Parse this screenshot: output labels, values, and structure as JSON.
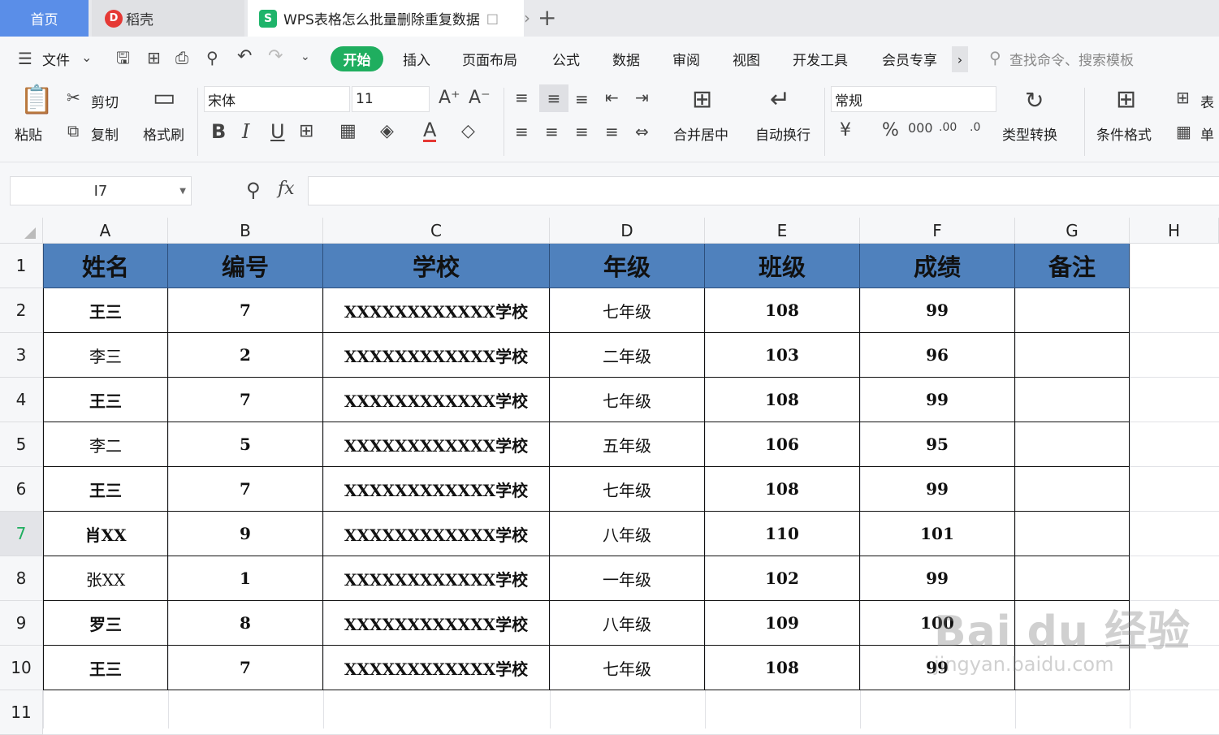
{
  "tabs": {
    "home": "首页",
    "daoke": "稻壳",
    "doc": "WPS表格怎么批量删除重复数据"
  },
  "menu": {
    "file": "文件",
    "items": [
      "开始",
      "插入",
      "页面布局",
      "公式",
      "数据",
      "审阅",
      "视图",
      "开发工具",
      "会员专享"
    ],
    "search_placeholder": "查找命令、搜索模板"
  },
  "ribbon": {
    "paste": "粘贴",
    "cut": "剪切",
    "copy": "复制",
    "format_painter": "格式刷",
    "font_name": "宋体",
    "font_size": "11",
    "merge_center": "合并居中",
    "wrap_text": "自动换行",
    "number_format": "常规",
    "type_convert": "类型转换",
    "cond_format": "条件格式",
    "table_style_partial": "表",
    "cell_partial": "单"
  },
  "formula_bar": {
    "cell_ref": "I7",
    "fx": "fx",
    "value": ""
  },
  "columns": [
    "A",
    "B",
    "C",
    "D",
    "E",
    "F",
    "G",
    "H"
  ],
  "rows": [
    "1",
    "2",
    "3",
    "4",
    "5",
    "6",
    "7",
    "8",
    "9",
    "10",
    "11"
  ],
  "selected_row": "7",
  "table": {
    "headers": [
      "姓名",
      "编号",
      "学校",
      "年级",
      "班级",
      "成绩",
      "备注"
    ],
    "data": [
      [
        "王三",
        "7",
        "XXXXXXXXXXXX学校",
        "七年级",
        "108",
        "99",
        ""
      ],
      [
        "李三",
        "2",
        "XXXXXXXXXXXX学校",
        "二年级",
        "103",
        "96",
        ""
      ],
      [
        "王三",
        "7",
        "XXXXXXXXXXXX学校",
        "七年级",
        "108",
        "99",
        ""
      ],
      [
        "李二",
        "5",
        "XXXXXXXXXXXX学校",
        "五年级",
        "106",
        "95",
        ""
      ],
      [
        "王三",
        "7",
        "XXXXXXXXXXXX学校",
        "七年级",
        "108",
        "99",
        ""
      ],
      [
        "肖XX",
        "9",
        "XXXXXXXXXXXX学校",
        "八年级",
        "110",
        "101",
        ""
      ],
      [
        "张XX",
        "1",
        "XXXXXXXXXXXX学校",
        "一年级",
        "102",
        "99",
        ""
      ],
      [
        "罗三",
        "8",
        "XXXXXXXXXXXX学校",
        "八年级",
        "109",
        "100",
        ""
      ],
      [
        "王三",
        "7",
        "XXXXXXXXXXXX学校",
        "七年级",
        "108",
        "99",
        ""
      ]
    ]
  },
  "colors": {
    "header_fill": "#4f81bd",
    "accent_green": "#1fae5f",
    "home_tab": "#5a8ee8"
  },
  "watermark": {
    "main": "Bai du 经验",
    "sub": "jingyan.baidu.com"
  }
}
